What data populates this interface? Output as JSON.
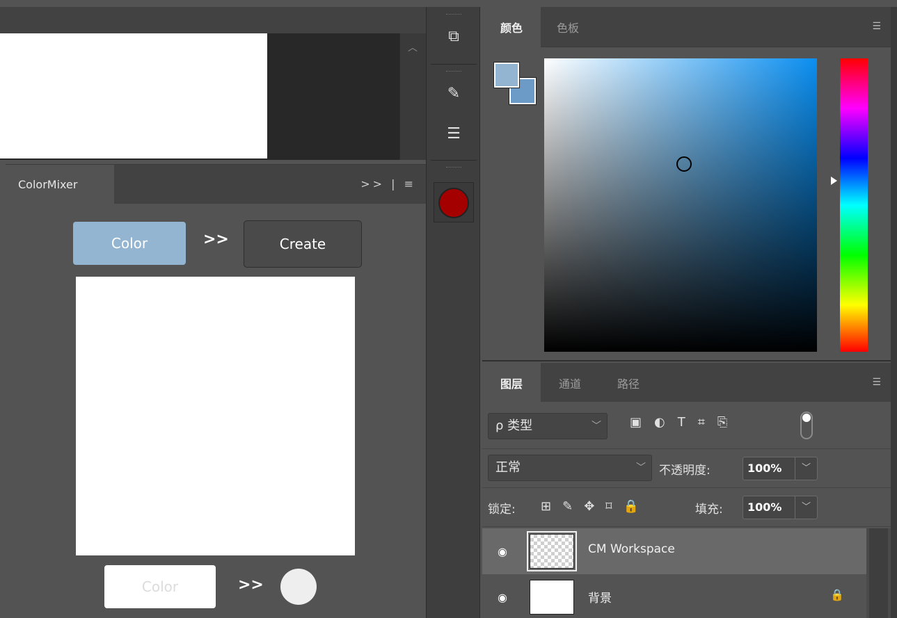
{
  "colormixer": {
    "tab_label": "ColorMixer",
    "tab_tools": ">> | ≡",
    "color_button": "Color",
    "arrow": ">>",
    "create_button": "Create",
    "color_button_2": "Color",
    "arrow_2": ">>",
    "swatch_colors": {
      "primary": "#93b5d2",
      "output": "#eeeeee"
    }
  },
  "toolbar": {
    "icons": [
      "history-icon",
      "brush-presets-icon",
      "brush-settings-icon",
      "swatch-icon"
    ],
    "swatch_color": "#a40000"
  },
  "color_panel": {
    "tabs": [
      {
        "label": "颜色",
        "active": true
      },
      {
        "label": "色板",
        "active": false
      }
    ],
    "foreground": "#93b5d2",
    "background": "#6b9bc6",
    "hue_color": "#0a8ef0"
  },
  "layers_panel": {
    "tabs": [
      {
        "label": "图层",
        "active": true
      },
      {
        "label": "通道",
        "active": false
      },
      {
        "label": "路径",
        "active": false
      }
    ],
    "filter": {
      "label": "ρ 类型"
    },
    "blend_mode": "正常",
    "opacity_label": "不透明度:",
    "opacity_value": "100%",
    "lock_label": "锁定:",
    "fill_label": "填充:",
    "fill_value": "100%",
    "layers": [
      {
        "name": "CM Workspace",
        "selected": true,
        "locked": false
      },
      {
        "name": "背景",
        "selected": false,
        "locked": true
      }
    ]
  }
}
